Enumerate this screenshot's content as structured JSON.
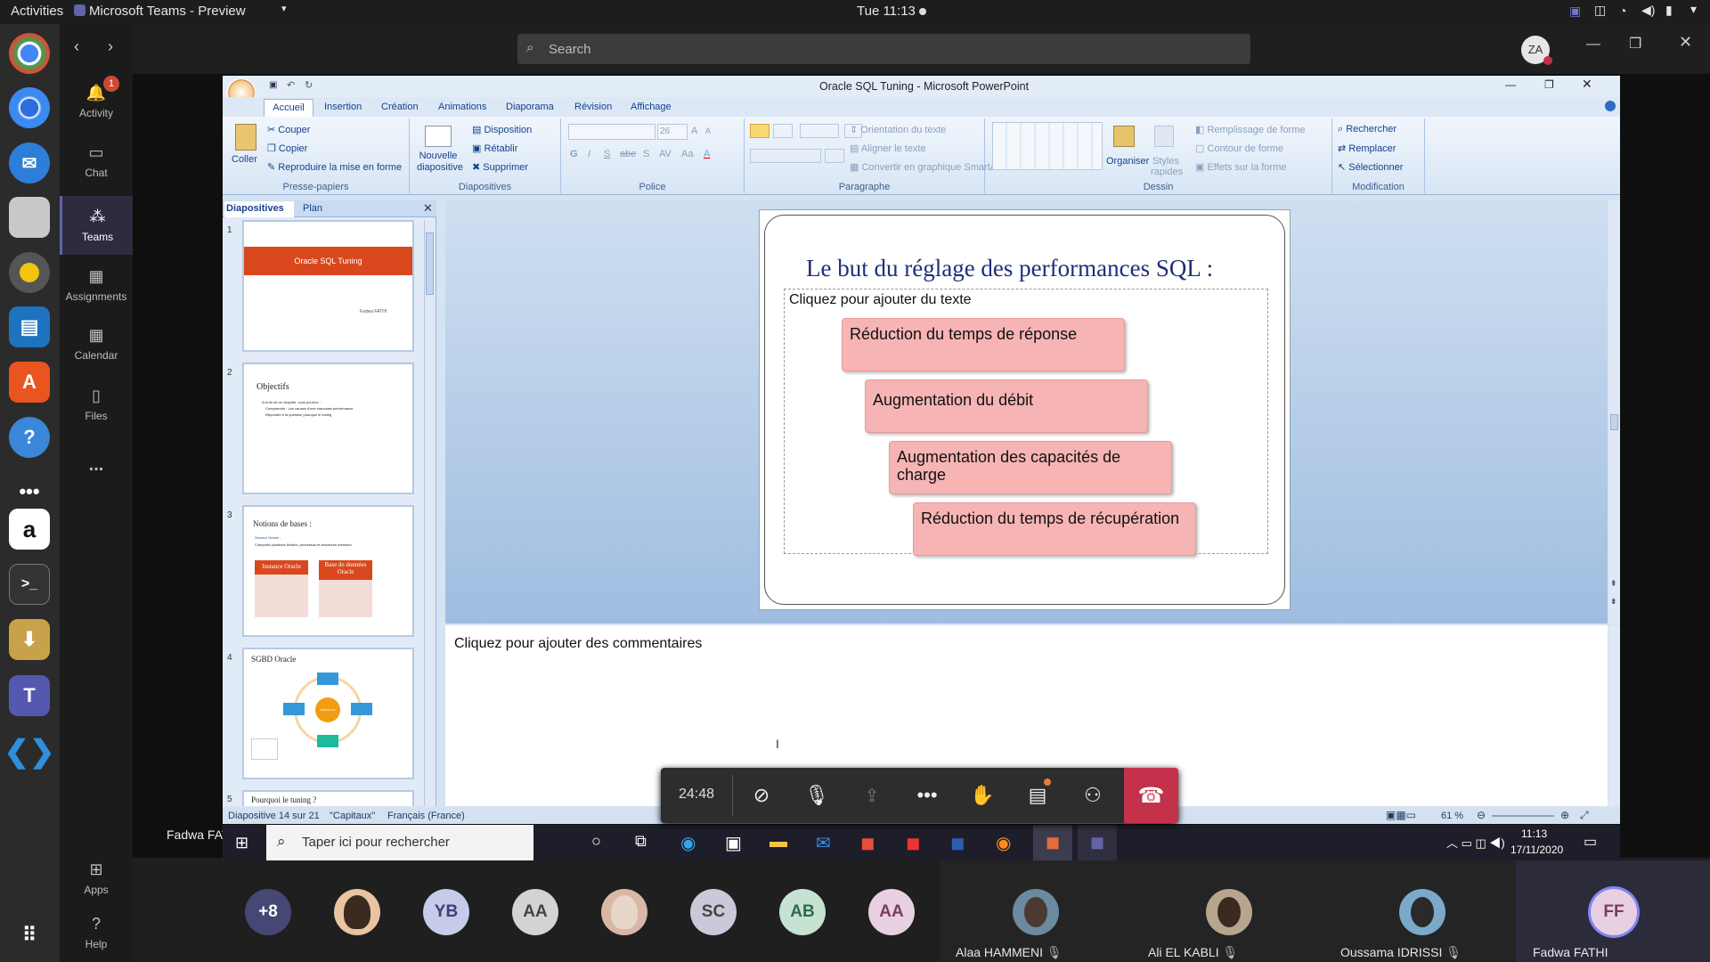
{
  "topbar": {
    "activities": "Activities",
    "app_menu": "Microsoft Teams - Preview",
    "clock": "Tue 11:13"
  },
  "teams": {
    "rail": [
      {
        "label": "Activity",
        "badge": "1"
      },
      {
        "label": "Chat"
      },
      {
        "label": "Teams"
      },
      {
        "label": "Assignments"
      },
      {
        "label": "Calendar"
      },
      {
        "label": "Files"
      },
      {
        "label": "..."
      }
    ],
    "apps_label": "Apps",
    "help_label": "Help",
    "search_placeholder": "Search",
    "user_initials": "ZA"
  },
  "ppt": {
    "title": "Oracle SQL Tuning - Microsoft PowerPoint",
    "tabs": [
      "Accueil",
      "Insertion",
      "Création",
      "Animations",
      "Diaporama",
      "Révision",
      "Affichage"
    ],
    "clipboard": {
      "paste": "Coller",
      "cut": "Couper",
      "copy": "Copier",
      "format_painter": "Reproduire la mise en forme",
      "label": "Presse-papiers"
    },
    "slides_group": {
      "new_slide": "Nouvelle diapositive",
      "layout": "Disposition",
      "reset": "Rétablir",
      "delete": "Supprimer",
      "label": "Diapositives"
    },
    "font_group": {
      "size": "26",
      "label": "Police",
      "bold": "G",
      "italic": "I",
      "underline": "S",
      "strike": "abe",
      "shadow": "S",
      "spacing": "AV",
      "case": "Aa",
      "color": "A",
      "grow": "A",
      "shrink": "A"
    },
    "paragraph_group": {
      "direction": "Orientation du texte",
      "align": "Aligner le texte",
      "smartart": "Convertir en graphique SmartArt",
      "label": "Paragraphe"
    },
    "drawing_group": {
      "arrange": "Organiser",
      "quick_styles": "Styles rapides",
      "fill": "Remplissage de forme",
      "outline": "Contour de forme",
      "effects": "Effets sur la forme",
      "label": "Dessin"
    },
    "editing_group": {
      "find": "Rechercher",
      "replace": "Remplacer",
      "select": "Sélectionner",
      "label": "Modification"
    },
    "pane_tabs": {
      "slides": "Diapositives",
      "outline": "Plan"
    },
    "thumbnails": [
      {
        "num": "1",
        "title": "Oracle SQL Tuning",
        "author": "Fadwa FATHI"
      },
      {
        "num": "2",
        "title": "Objectifs",
        "line1": "A la fin de ce chapitre, vous pourrez :",
        "line2": "Comprendre : Les causes d'une mauvaise performance",
        "line3": "Répondre à la question pourquoi le tuning"
      },
      {
        "num": "3",
        "title": "Notions de bases :",
        "sub": "Serveur Oracle :",
        "line": "Comporte plusieurs fichiers, processus et structures mémoire.",
        "box1": "Instance Oracle",
        "box2": "Base de données Oracle"
      },
      {
        "num": "4",
        "title": "SGBD Oracle",
        "center": "SGBDOracle"
      },
      {
        "num": "5",
        "title": "Pourquoi le tuning ?"
      }
    ],
    "slide": {
      "title": "Le but du réglage des performances SQL :",
      "placeholder": "Cliquez pour ajouter du texte",
      "items": [
        "Réduction du temps de réponse",
        "Augmentation du débit",
        "Augmentation des capacités de charge",
        "Réduction du temps de récupération"
      ]
    },
    "notes_placeholder": "Cliquez pour ajouter des commentaires",
    "status": {
      "slide": "Diapositive 14 sur 21",
      "theme": "\"Capitaux\"",
      "language": "Français (France)",
      "zoom": "61 %"
    }
  },
  "windows": {
    "presenter": "Fadwa FATHI",
    "search": "Taper ici pour rechercher",
    "time": "11:13",
    "date": "17/11/2020"
  },
  "call": {
    "duration": "24:48"
  },
  "participants": {
    "overflow": "+8",
    "avatars": [
      {
        "initials": "YB",
        "color": "#c5cbe8"
      },
      {
        "initials": "AA",
        "color": "#d3d3d3"
      },
      {
        "initials": "SC",
        "color": "#c9c9d9"
      },
      {
        "initials": "AB",
        "color": "#c6e2d2"
      },
      {
        "initials": "AA",
        "color": "#e9d0e0"
      }
    ],
    "named": [
      "Alaa HAMMENI",
      "Ali EL KABLI",
      "Oussama IDRISSI",
      "Fadwa FATHI"
    ],
    "self_initials": "FF"
  }
}
